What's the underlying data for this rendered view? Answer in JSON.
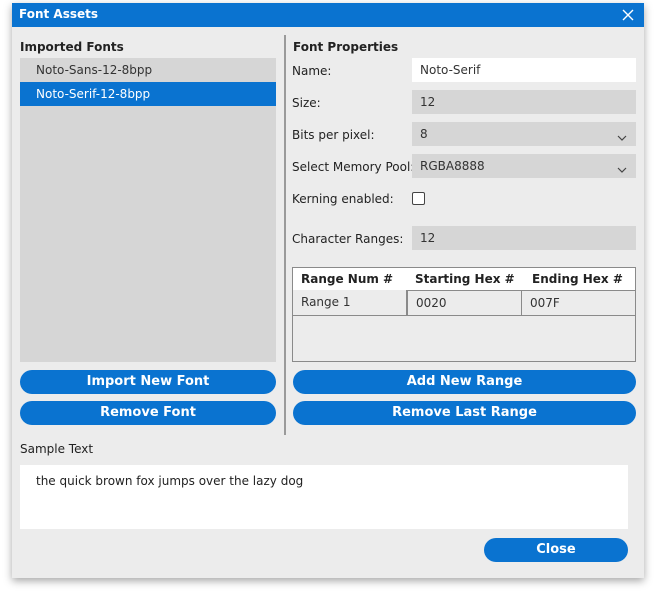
{
  "window": {
    "title": "Font Assets"
  },
  "imported": {
    "title": "Imported Fonts",
    "fonts": [
      {
        "label": "Noto-Sans-12-8bpp",
        "selected": false
      },
      {
        "label": "Noto-Serif-12-8bpp",
        "selected": true
      }
    ],
    "import_label": "Import New Font",
    "remove_label": "Remove Font"
  },
  "properties": {
    "title": "Font Properties",
    "name_label": "Name:",
    "name_value": "Noto-Serif",
    "size_label": "Size:",
    "size_value": "12",
    "bpp_label": "Bits per pixel:",
    "bpp_value": "8",
    "pool_label": "Select Memory Pool:",
    "pool_value": "RGBA8888",
    "kerning_label": "Kerning enabled:",
    "kerning_checked": false,
    "ranges_label": "Character Ranges:",
    "ranges_value": "12"
  },
  "range_table": {
    "columns": [
      "Range Num #",
      "Starting Hex #",
      "Ending Hex #"
    ],
    "rows": [
      {
        "name": "Range 1",
        "start": "0020",
        "end": "007F"
      }
    ],
    "add_label": "Add New Range",
    "remove_label": "Remove Last Range"
  },
  "sample": {
    "label": "Sample Text",
    "text": "the quick brown fox jumps over the lazy dog"
  },
  "close_label": "Close",
  "colors": {
    "accent": "#0a73d0",
    "panel": "#ececec",
    "field": "#d6d6d6"
  }
}
